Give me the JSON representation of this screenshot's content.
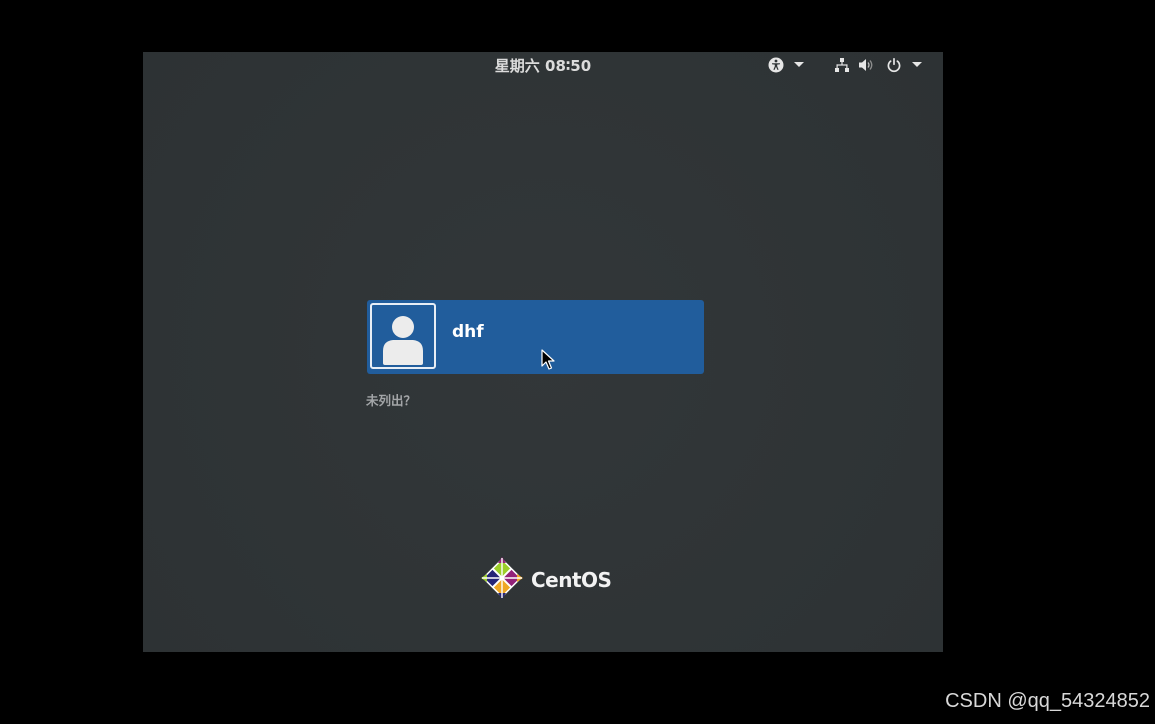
{
  "top_bar": {
    "clock": "星期六 08∶50",
    "accessibility_menu_icon": "accessibility-icon",
    "network_icon": "network-wired-icon",
    "volume_icon": "volume-icon",
    "power_icon": "power-icon"
  },
  "login": {
    "users": [
      {
        "name": "dhf",
        "avatar_icon": "user-avatar-icon"
      }
    ],
    "not_listed_label": "未列出？"
  },
  "branding": {
    "logo_icon": "centos-logo-icon",
    "logo_text": "CentOS"
  },
  "watermark": "CSDN @qq_54324852",
  "colors": {
    "background": "#2f3436",
    "selected_user": "#215d9c",
    "text_primary": "#ffffff",
    "text_secondary": "#a3a6a8"
  }
}
